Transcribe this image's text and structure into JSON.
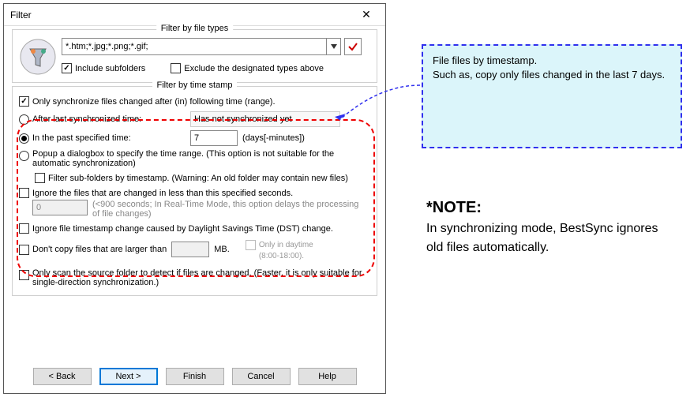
{
  "window": {
    "title": "Filter"
  },
  "group_filetypes": {
    "legend": "Filter by file types",
    "filter_value": "*.htm;*.jpg;*.png;*.gif;",
    "include_subfolders": "Include subfolders",
    "exclude_types": "Exclude the designated types above"
  },
  "group_timestamp": {
    "legend": "Filter by time stamp",
    "only_sync": "Only synchronize files changed after (in) following time (range).",
    "after_last": "After last synchronized time:",
    "after_last_value": "Has not synchronized yet",
    "in_past": "In the past specified time:",
    "in_past_value": "7",
    "in_past_unit": "(days[-minutes])",
    "popup_range": "Popup a dialogbox to specify the time range. (This option is not suitable for the automatic synchronization)",
    "filter_subfolders_ts": "Filter sub-folders by timestamp. (Warning: An old folder may contain new files)",
    "ignore_seconds": "Ignore the files that are changed in less than this specified seconds.",
    "ignore_seconds_value": "0",
    "ignore_seconds_hint": "(<900 seconds; In Real-Time Mode, this option delays the processing of file changes)",
    "ignore_dst": "Ignore file timestamp change caused by Daylight Savings Time (DST) change.",
    "dont_copy_larger": "Don't copy files that are larger than",
    "dont_copy_larger_unit": "MB.",
    "dont_copy_value": "",
    "only_daytime": "Only in daytime",
    "only_daytime_hours": "(8:00-18:00).",
    "only_scan": "Only scan the source folder to detect if files are changed. (Faster, it is only suitable for single-direction synchronization.)"
  },
  "buttons": {
    "back": "< Back",
    "next": "Next >",
    "finish": "Finish",
    "cancel": "Cancel",
    "help": "Help"
  },
  "callout": {
    "text": "File files by timestamp.\nSuch as, copy only files changed in the last 7 days."
  },
  "note": {
    "heading": "*NOTE:",
    "body": "In synchronizing mode, BestSync ignores old files automatically."
  }
}
